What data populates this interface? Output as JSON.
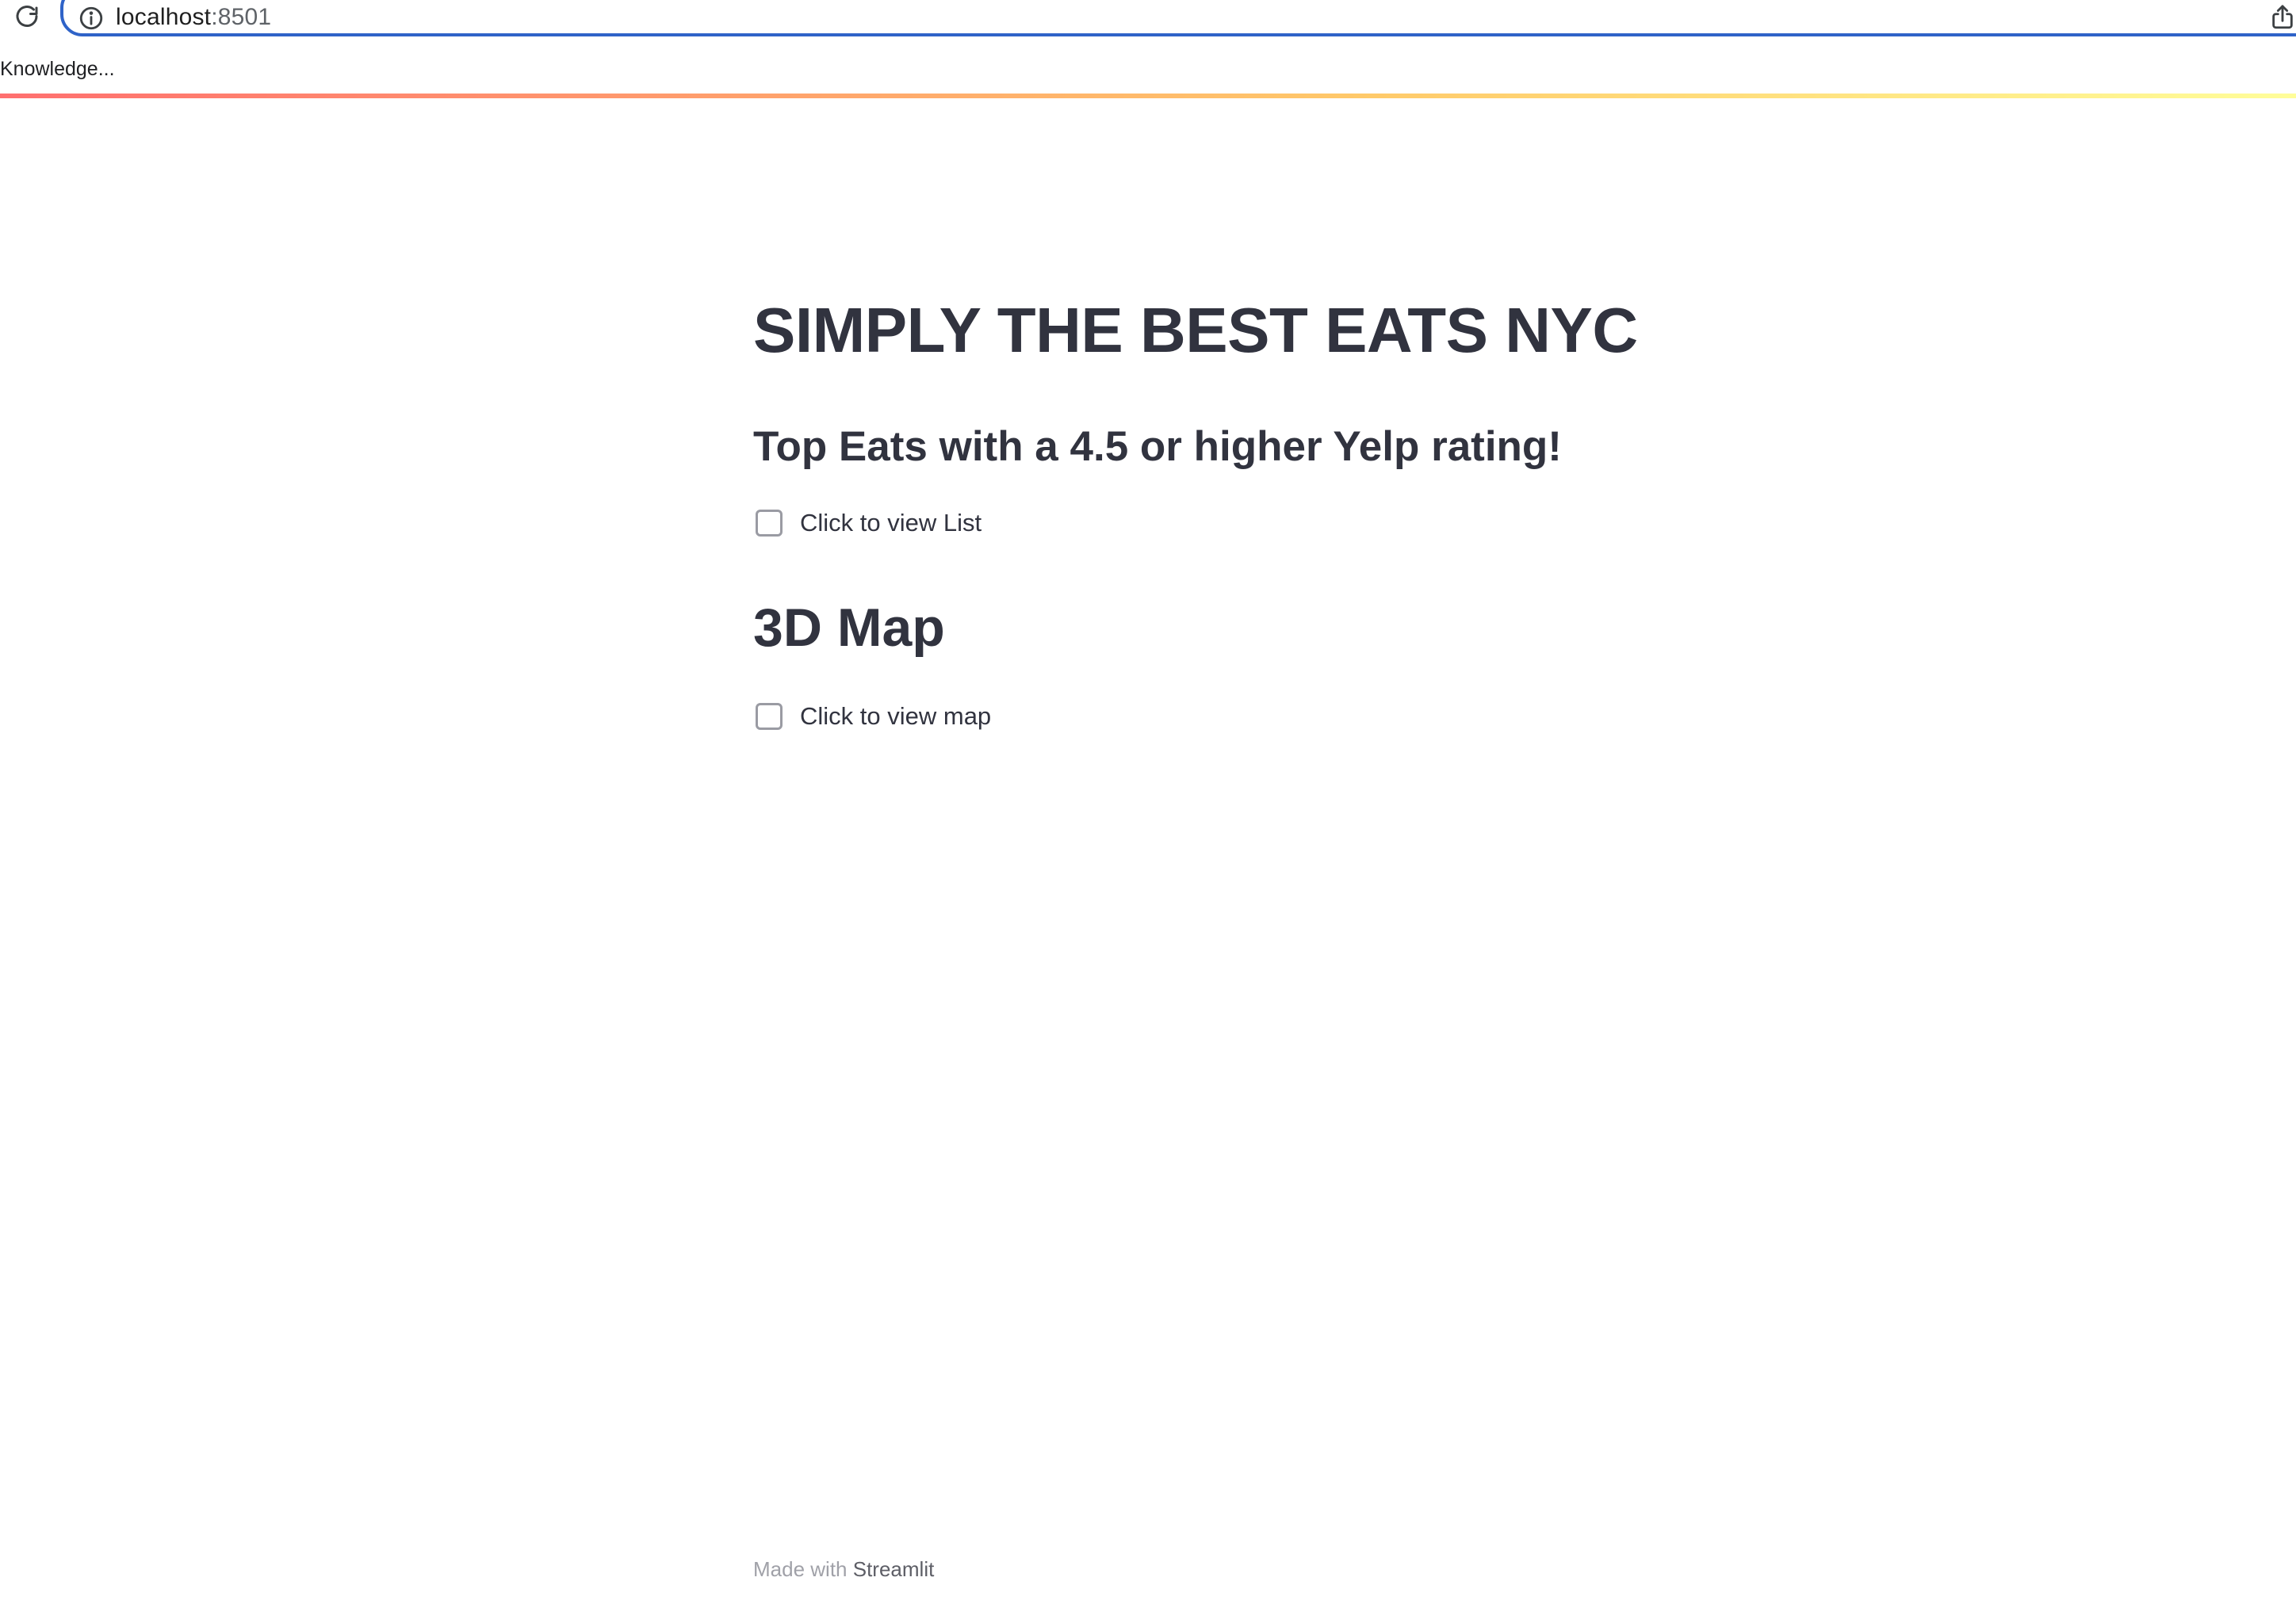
{
  "browser": {
    "url_host": "localhost",
    "url_port": ":8501",
    "bookmark_label": "Knowledge..."
  },
  "app": {
    "title": "SIMPLY THE BEST EATS NYC",
    "subheader": "Top Eats with a 4.5 or higher Yelp rating!",
    "list_checkbox": {
      "label": "Click to view List",
      "checked": false
    },
    "map_section_header": "3D Map",
    "map_checkbox": {
      "label": "Click to view map",
      "checked": false
    }
  },
  "footer": {
    "prefix": "Made with",
    "link": "Streamlit"
  },
  "icons": {
    "reload": "reload-icon",
    "site_info": "info-icon",
    "share": "share-icon"
  },
  "colors": {
    "address_focus_ring": "#2f63c8",
    "text_primary": "#31333f",
    "footer_text": "#a0a1a8",
    "decoration_start": "#ff4b4b",
    "decoration_mid": "#ffbd45",
    "decoration_end": "#fffd80"
  }
}
